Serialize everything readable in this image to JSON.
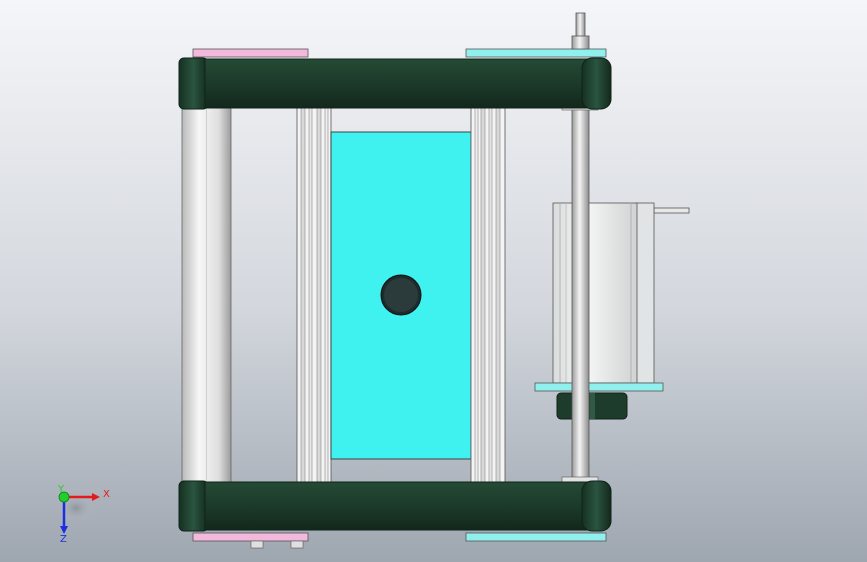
{
  "app": {
    "background_top": "#f5f6f9",
    "background_bottom": "#9ea6b0"
  },
  "colors": {
    "dark_green": "#1e3c2c",
    "dark_green_edge": "#0f2219",
    "cyan_panel": "#3ff2f0",
    "pink_plate": "#f3b9dc",
    "cyan_plate": "#8ff0ee",
    "rod_light": "#f2f2f2",
    "rod_mid": "#c9c9c9",
    "motor_light": "#eef0f0"
  },
  "triad": {
    "x_label": "X",
    "y_label": "Y",
    "z_label": "Z",
    "x_color": "#e21c1c",
    "y_color": "#1fcf2b",
    "z_color": "#1c2ee2"
  },
  "model": {
    "parts": [
      "top-frame-bar",
      "bottom-frame-bar",
      "left-guide-rod",
      "center-cyan-plate",
      "left-rail",
      "right-rail",
      "drive-shaft",
      "stepper-motor",
      "coupling",
      "end-plates"
    ]
  }
}
